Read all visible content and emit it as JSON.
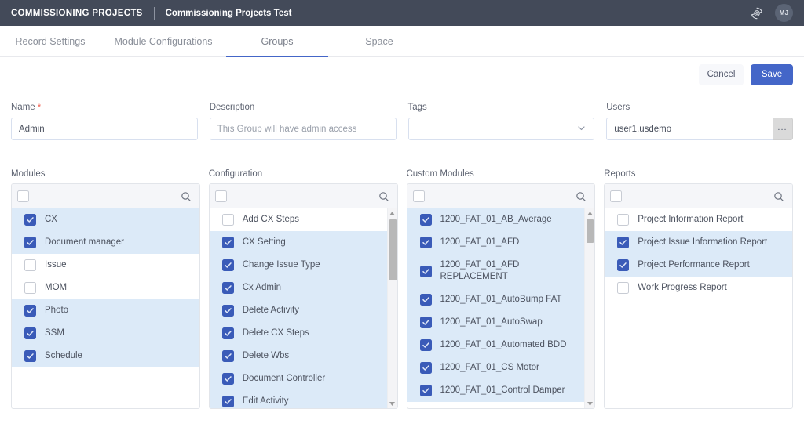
{
  "topbar": {
    "title": "COMMISSIONING PROJECTS",
    "subtitle": "Commissioning Projects Test",
    "sync_icon": "sync-gear-icon",
    "avatar_initials": "MJ"
  },
  "tabs": [
    {
      "label": "Record Settings",
      "active": false
    },
    {
      "label": "Module Configurations",
      "active": false
    },
    {
      "label": "Groups",
      "active": true
    },
    {
      "label": "Space",
      "active": false
    }
  ],
  "actions": {
    "cancel_label": "Cancel",
    "save_label": "Save"
  },
  "form": {
    "name": {
      "label": "Name",
      "required_marker": "*",
      "value": "Admin",
      "placeholder": ""
    },
    "description": {
      "label": "Description",
      "value": "",
      "placeholder": "This Group will have admin access"
    },
    "tags": {
      "label": "Tags",
      "value": "",
      "placeholder": ""
    },
    "users": {
      "label": "Users",
      "value": "user1,usdemo",
      "placeholder": "",
      "more_button": "..."
    }
  },
  "panels": [
    {
      "label": "Modules",
      "search_placeholder": "",
      "select_all_checked": false,
      "has_scrollbar": false,
      "items": [
        {
          "label": "CX",
          "checked": true
        },
        {
          "label": "Document manager",
          "checked": true
        },
        {
          "label": "Issue",
          "checked": false
        },
        {
          "label": "MOM",
          "checked": false
        },
        {
          "label": "Photo",
          "checked": true
        },
        {
          "label": "SSM",
          "checked": true
        },
        {
          "label": "Schedule",
          "checked": true
        }
      ]
    },
    {
      "label": "Configuration",
      "search_placeholder": "",
      "select_all_checked": false,
      "has_scrollbar": true,
      "items": [
        {
          "label": "Add CX Steps",
          "checked": false
        },
        {
          "label": "CX Setting",
          "checked": true
        },
        {
          "label": "Change Issue Type",
          "checked": true
        },
        {
          "label": "Cx Admin",
          "checked": true
        },
        {
          "label": "Delete Activity",
          "checked": true
        },
        {
          "label": "Delete CX Steps",
          "checked": true
        },
        {
          "label": "Delete Wbs",
          "checked": true
        },
        {
          "label": "Document Controller",
          "checked": true
        },
        {
          "label": "Edit Activity",
          "checked": true
        }
      ]
    },
    {
      "label": "Custom Modules",
      "search_placeholder": "",
      "select_all_checked": false,
      "has_scrollbar": true,
      "items": [
        {
          "label": "1200_FAT_01_AB_Average",
          "checked": true
        },
        {
          "label": "1200_FAT_01_AFD",
          "checked": true
        },
        {
          "label": "1200_FAT_01_AFD REPLACEMENT",
          "checked": true,
          "two_line": true
        },
        {
          "label": "1200_FAT_01_AutoBump FAT",
          "checked": true
        },
        {
          "label": "1200_FAT_01_AutoSwap",
          "checked": true
        },
        {
          "label": "1200_FAT_01_Automated BDD",
          "checked": true
        },
        {
          "label": "1200_FAT_01_CS Motor",
          "checked": true
        },
        {
          "label": "1200_FAT_01_Control Damper",
          "checked": true
        }
      ]
    },
    {
      "label": "Reports",
      "search_placeholder": "",
      "select_all_checked": false,
      "has_scrollbar": false,
      "items": [
        {
          "label": "Project Information Report",
          "checked": false
        },
        {
          "label": "Project Issue Information Report",
          "checked": true
        },
        {
          "label": "Project Performance Report",
          "checked": true
        },
        {
          "label": "Work Progress Report",
          "checked": false
        }
      ]
    }
  ],
  "colors": {
    "header_bg": "#434a59",
    "accent": "#4466c8",
    "checkbox_checked": "#3a5bb8",
    "row_selected": "#dceaf8",
    "required_star": "#f05a4a"
  }
}
